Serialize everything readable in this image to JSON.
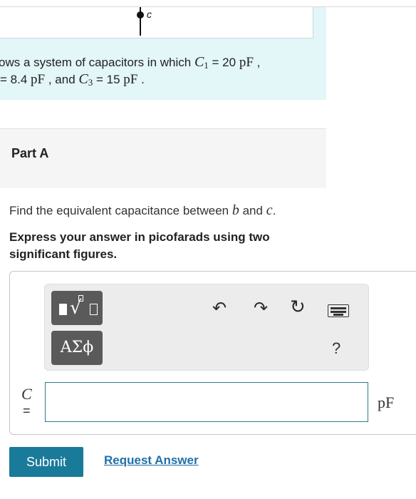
{
  "figure": {
    "node_label": "c"
  },
  "intro": {
    "line1_prefix": "ows a system of capacitors in which",
    "c1_symbol": "C",
    "c1_sub": "1",
    "c1_value": "= 20",
    "c1_unit": "pF",
    "line1_suffix": ",",
    "line2_prefix": "= 8.4",
    "c2_unit": "pF",
    "line2_mid": ", and",
    "c3_symbol": "C",
    "c3_sub": "3",
    "c3_value": "= 15",
    "c3_unit": "pF",
    "line2_suffix": "."
  },
  "part": {
    "title": "Part A"
  },
  "question": {
    "prefix": "Find the equivalent capacitance between",
    "var_b": "b",
    "and": "and",
    "var_c": "c",
    "end": ".",
    "instruction": "Express your answer in picofarads using two significant figures."
  },
  "toolbar": {
    "templates_icon": "templates-icon",
    "greek_label": "ΑΣϕ",
    "undo_icon": "↶",
    "redo_icon": "↷",
    "reset_icon": "↻",
    "help_label": "?"
  },
  "answer": {
    "var_label": "C",
    "equals": "=",
    "value": "",
    "unit": "pF"
  },
  "actions": {
    "submit_label": "Submit",
    "request_label": "Request Answer"
  },
  "colors": {
    "intro_bg": "#e3f6f8",
    "submit_bg": "#1a7a99",
    "link": "#1f6fa8",
    "input_border": "#2b7c8f"
  }
}
